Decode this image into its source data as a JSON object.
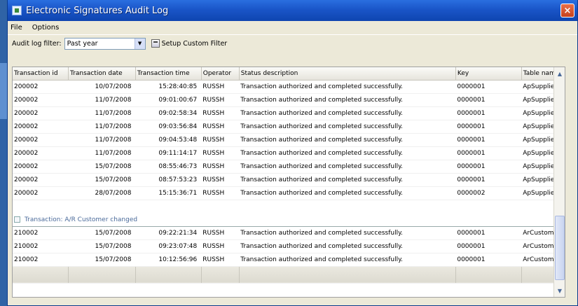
{
  "window": {
    "title": "Electronic Signatures Audit Log",
    "close_label": "×"
  },
  "menu": {
    "file": "File",
    "options": "Options"
  },
  "toolbar": {
    "filter_label": "Audit log filter:",
    "filter_value": "Past year",
    "filter_arrow": "▼",
    "setup_label": "Setup Custom Filter"
  },
  "columns": [
    "Transaction id",
    "Transaction date",
    "Transaction time",
    "Operator",
    "Status description",
    "Key",
    "Table name"
  ],
  "rows_group1": [
    {
      "id": "200002",
      "date": "10/07/2008",
      "time": "15:28:40:85",
      "operator": "RUSSH",
      "status": "Transaction authorized and completed successfully.",
      "key": "0000001",
      "table": "ApSupplier"
    },
    {
      "id": "200002",
      "date": "11/07/2008",
      "time": "09:01:00:67",
      "operator": "RUSSH",
      "status": "Transaction authorized and completed successfully.",
      "key": "0000001",
      "table": "ApSupplier"
    },
    {
      "id": "200002",
      "date": "11/07/2008",
      "time": "09:02:58:34",
      "operator": "RUSSH",
      "status": "Transaction authorized and completed successfully.",
      "key": "0000001",
      "table": "ApSupplier"
    },
    {
      "id": "200002",
      "date": "11/07/2008",
      "time": "09:03:56:84",
      "operator": "RUSSH",
      "status": "Transaction authorized and completed successfully.",
      "key": "0000001",
      "table": "ApSupplier"
    },
    {
      "id": "200002",
      "date": "11/07/2008",
      "time": "09:04:53:48",
      "operator": "RUSSH",
      "status": "Transaction authorized and completed successfully.",
      "key": "0000001",
      "table": "ApSupplier"
    },
    {
      "id": "200002",
      "date": "11/07/2008",
      "time": "09:11:14:17",
      "operator": "RUSSH",
      "status": "Transaction authorized and completed successfully.",
      "key": "0000001",
      "table": "ApSupplier"
    },
    {
      "id": "200002",
      "date": "15/07/2008",
      "time": "08:55:46:73",
      "operator": "RUSSH",
      "status": "Transaction authorized and completed successfully.",
      "key": "0000001",
      "table": "ApSupplier"
    },
    {
      "id": "200002",
      "date": "15/07/2008",
      "time": "08:57:53:23",
      "operator": "RUSSH",
      "status": "Transaction authorized and completed successfully.",
      "key": "0000001",
      "table": "ApSupplier"
    },
    {
      "id": "200002",
      "date": "28/07/2008",
      "time": "15:15:36:71",
      "operator": "RUSSH",
      "status": "Transaction authorized and completed successfully.",
      "key": "0000002",
      "table": "ApSupplier"
    }
  ],
  "group2": {
    "label": "Transaction: A/R Customer changed"
  },
  "rows_group2": [
    {
      "id": "210002",
      "date": "15/07/2008",
      "time": "09:22:21:34",
      "operator": "RUSSH",
      "status": "Transaction authorized and completed successfully.",
      "key": "0000001",
      "table": "ArCustomer"
    },
    {
      "id": "210002",
      "date": "15/07/2008",
      "time": "09:23:07:48",
      "operator": "RUSSH",
      "status": "Transaction authorized and completed successfully.",
      "key": "0000001",
      "table": "ArCustomer"
    },
    {
      "id": "210002",
      "date": "15/07/2008",
      "time": "10:12:56:96",
      "operator": "RUSSH",
      "status": "Transaction authorized and completed successfully.",
      "key": "0000001",
      "table": "ArCustomer"
    }
  ],
  "scroll": {
    "up": "▲",
    "down": "▼"
  },
  "colors": {
    "titlebar": "#1a55c8",
    "group_text": "#4a6a9a"
  }
}
